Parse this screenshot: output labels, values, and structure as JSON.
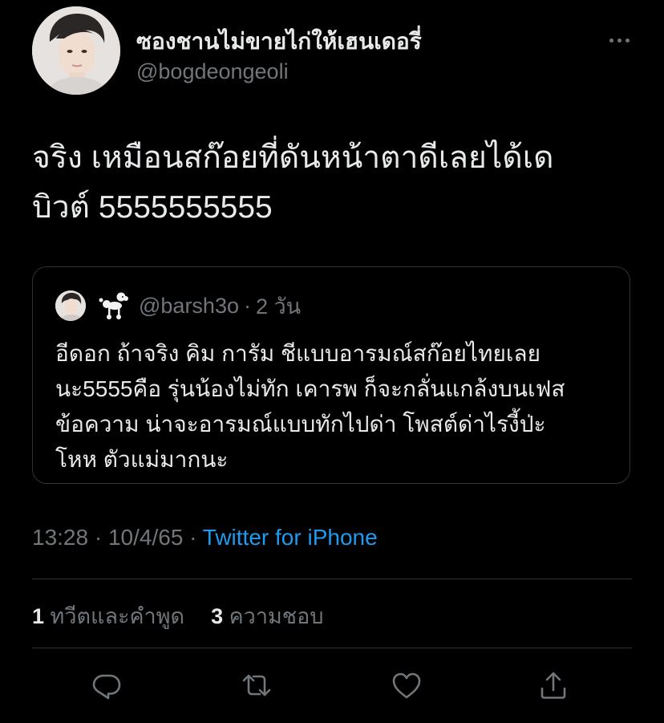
{
  "tweet": {
    "author": {
      "display_name": "ซองชานไม่ขายไก่ให้เฮนเดอรี่",
      "handle": "@bogdeongeoli"
    },
    "more_icon": "more-horizontal-icon",
    "text": "จริง เหมือนสก๊อยที่ดันหน้าตาดีเลยได้เด\nบิวต์ 5555555555",
    "quote": {
      "avatar_emoji_icon": "poodle-icon",
      "handle": "@barsh3o",
      "separator": "·",
      "time": "2 วัน",
      "text": "อีดอก ถ้าจริง คิม การัม ชีแบบอารมณ์สก๊อยไทยเลย\nนะ5555คือ รุ่นน้องไม่ทัก เคารพ ก็จะกลั่นแกล้งบนเฟส\nข้อความ น่าจะอารมณ์แบบทักไปด่า โพสต์ด่าไรงี้ป่ะ\nโหห ตัวแม่มากนะ"
    },
    "meta": {
      "time": "13:28",
      "separator": "·",
      "date": "10/4/65",
      "source": "Twitter for iPhone"
    },
    "stats": {
      "retweets_count": "1",
      "retweets_label": "ทวีตและคำพูด",
      "likes_count": "3",
      "likes_label": "ความชอบ"
    },
    "actions": [
      {
        "icon": "reply-icon"
      },
      {
        "icon": "retweet-icon"
      },
      {
        "icon": "like-icon"
      },
      {
        "icon": "share-icon"
      }
    ]
  },
  "colors": {
    "background": "#000000",
    "primary_text": "#e7e9ea",
    "secondary_text": "#71767b",
    "link": "#1d9bf0",
    "border": "#2f3336"
  }
}
